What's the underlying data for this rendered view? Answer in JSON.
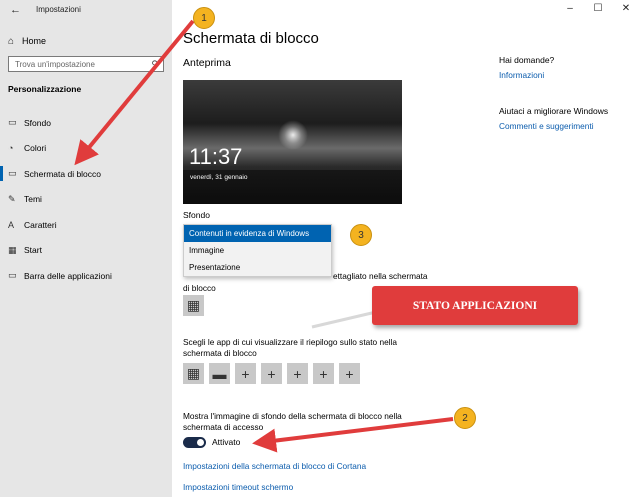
{
  "window": {
    "title": "Impostazioni",
    "back": "←",
    "minimize": "–",
    "maximize": "☐",
    "close": "✕"
  },
  "sidebar": {
    "home": {
      "label": "Home",
      "icon": "⌂"
    },
    "search_placeholder": "Trova un'impostazione",
    "search_icon": "⚲",
    "section": "Personalizzazione",
    "items": [
      {
        "label": "Sfondo",
        "icon": "▭",
        "active": false
      },
      {
        "label": "Colori",
        "icon": "◔",
        "active": false
      },
      {
        "label": "Schermata di blocco",
        "icon": "▭",
        "active": true
      },
      {
        "label": "Temi",
        "icon": "✎",
        "active": false
      },
      {
        "label": "Caratteri",
        "icon": "A",
        "active": false
      },
      {
        "label": "Start",
        "icon": "▦",
        "active": false
      },
      {
        "label": "Barra delle applicazioni",
        "icon": "▭",
        "active": false
      }
    ]
  },
  "main": {
    "title": "Schermata di blocco",
    "preview_heading": "Anteprima",
    "preview_time": "11:37",
    "preview_date": "venerdì, 31 gennaio",
    "background_label": "Sfondo",
    "background_options": [
      "Contenuti in evidenza di Windows",
      "Immagine",
      "Presentazione"
    ],
    "background_selected": "Contenuti in evidenza di Windows",
    "detail_text_a": "ettagliato nella schermata",
    "detail_text_b": "di blocco",
    "calendar_icon": "▦",
    "status_text": "Scegli le app di cui visualizzare il riepilogo sullo stato nella schermata di blocco",
    "status_apps": [
      "▦",
      "▬",
      "+",
      "+",
      "+",
      "+",
      "+"
    ],
    "bg_text": "Mostra l'immagine di sfondo della schermata di blocco nella schermata di accesso",
    "toggle_label": "Attivato",
    "toggle_on": true,
    "link_cortana": "Impostazioni della schermata di blocco di Cortana",
    "link_timeout": "Impostazioni timeout schermo"
  },
  "help": {
    "question": "Hai domande?",
    "info_link": "Informazioni",
    "improve": "Aiutaci a migliorare Windows",
    "feedback_link": "Commenti e suggerimenti"
  },
  "annotations": {
    "bubble_1": "1",
    "bubble_2": "2",
    "bubble_3": "3",
    "banner": "STATO APPLICAZIONI",
    "arrow_color": "#e03c3c",
    "bubble_color": "#f4b320"
  }
}
